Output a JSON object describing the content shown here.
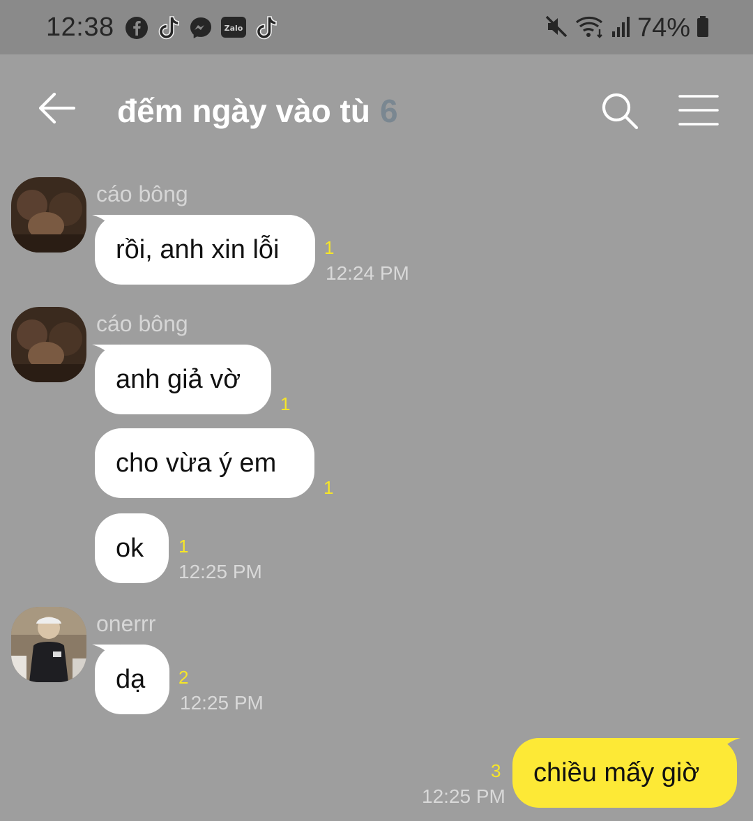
{
  "status_bar": {
    "time": "12:38",
    "battery": "74%",
    "left_icons": [
      "facebook-icon",
      "tiktok-icon",
      "messenger-icon",
      "zalo-icon",
      "tiktok-icon"
    ],
    "zalo_label": "Zalo",
    "right_icons": [
      "mute-icon",
      "wifi-icon",
      "signal-icon",
      "battery-icon"
    ]
  },
  "header": {
    "title": "đếm ngày vào tù",
    "member_count": "6"
  },
  "messages": [
    {
      "sender": "cáo bông",
      "text": "rồi, anh xin lỗi",
      "unread": "1",
      "time": "12:24 PM"
    },
    {
      "sender": "cáo bông",
      "text": "anh giả vờ",
      "unread": "1"
    },
    {
      "text": "cho vừa ý em",
      "unread": "1"
    },
    {
      "text": "ok",
      "unread": "1",
      "time": "12:25 PM"
    },
    {
      "sender": "onerrr",
      "text": "dạ",
      "unread": "2",
      "time": "12:25 PM"
    },
    {
      "text": "chiều mấy giờ",
      "unread": "3",
      "time": "12:25 PM",
      "mine": true
    }
  ],
  "colors": {
    "background": "#9e9e9e",
    "status_bar": "#8a8a8a",
    "my_bubble": "#fde936",
    "other_bubble": "#ffffff",
    "unread": "#f7e627"
  }
}
